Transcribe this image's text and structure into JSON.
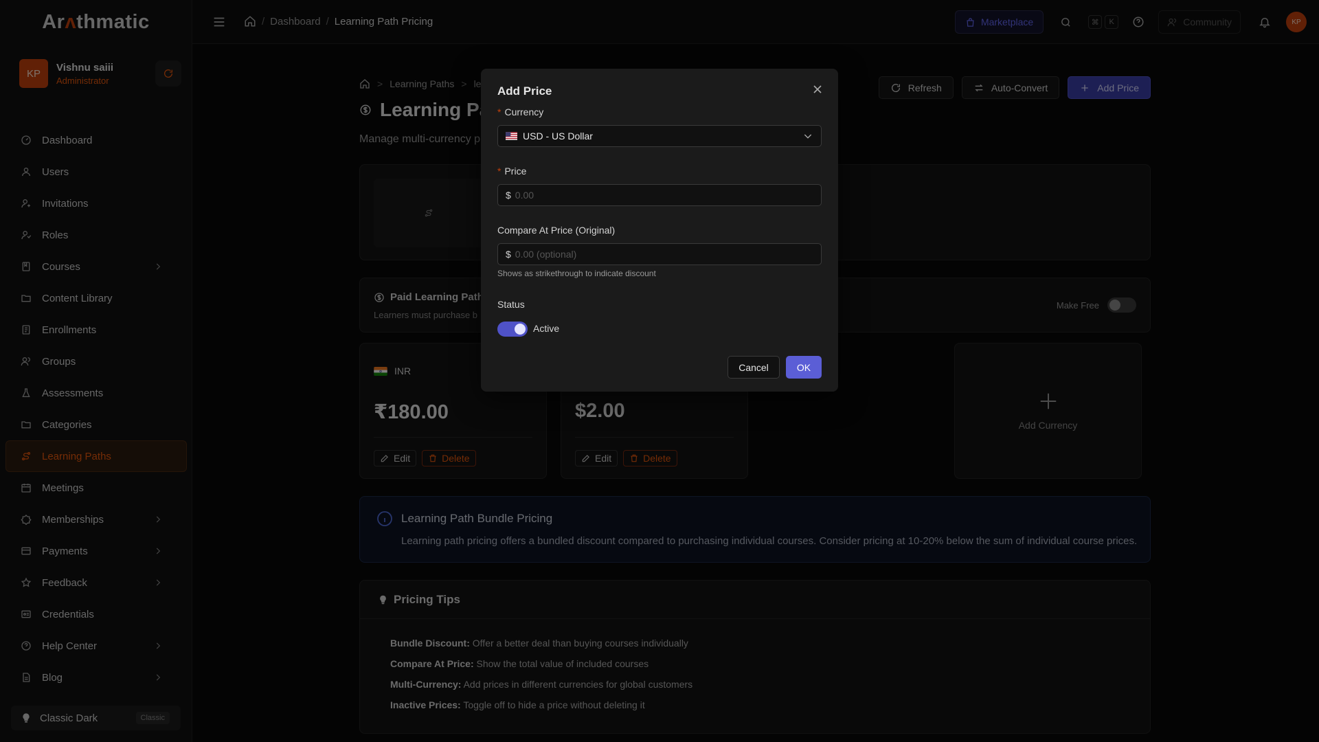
{
  "app": {
    "logo_pre": "Ar",
    "logo_mid": "ʌ",
    "logo_post": "thmatic"
  },
  "user": {
    "initials": "KP",
    "name": "Vishnu saiii",
    "role": "Administrator"
  },
  "sidebar": {
    "items": [
      {
        "label": "Dashboard",
        "icon": "dashboard-icon"
      },
      {
        "label": "Users",
        "icon": "user-icon"
      },
      {
        "label": "Invitations",
        "icon": "user-plus-icon"
      },
      {
        "label": "Roles",
        "icon": "roles-icon"
      },
      {
        "label": "Courses",
        "icon": "book-icon",
        "expandable": true
      },
      {
        "label": "Content Library",
        "icon": "folder-icon"
      },
      {
        "label": "Enrollments",
        "icon": "enrollment-icon"
      },
      {
        "label": "Groups",
        "icon": "group-icon"
      },
      {
        "label": "Assessments",
        "icon": "flask-icon"
      },
      {
        "label": "Categories",
        "icon": "folder-icon"
      },
      {
        "label": "Learning Paths",
        "icon": "route-icon",
        "active": true
      },
      {
        "label": "Meetings",
        "icon": "calendar-icon"
      },
      {
        "label": "Memberships",
        "icon": "badge-icon",
        "expandable": true
      },
      {
        "label": "Payments",
        "icon": "card-icon",
        "expandable": true
      },
      {
        "label": "Feedback",
        "icon": "star-icon",
        "expandable": true
      },
      {
        "label": "Credentials",
        "icon": "certificate-icon"
      },
      {
        "label": "Help Center",
        "icon": "help-icon",
        "expandable": true
      },
      {
        "label": "Blog",
        "icon": "document-icon",
        "expandable": true
      }
    ],
    "theme": {
      "label": "Classic Dark",
      "tag": "Classic"
    }
  },
  "topbar": {
    "breadcrumb": [
      "Dashboard",
      "Learning Path Pricing"
    ],
    "marketplace": "Marketplace",
    "kbd": [
      "⌘",
      "K"
    ],
    "community": "Community",
    "avatar_initials": "KP"
  },
  "page": {
    "breadcrumb": [
      "Learning Paths",
      "le"
    ],
    "title": "Learning Pa",
    "subtitle": "Manage multi-currency p",
    "actions": {
      "refresh": "Refresh",
      "auto_convert": "Auto-Convert",
      "add_price": "Add Price"
    },
    "paid": {
      "title": "Paid Learning Path",
      "subtitle": "Learners must purchase b",
      "make_free": "Make Free",
      "make_free_on": false
    },
    "prices": [
      {
        "currency": "INR",
        "amount": "₹180.00"
      },
      {
        "currency": "",
        "amount": "$2.00"
      }
    ],
    "edit": "Edit",
    "delete": "Delete",
    "add_currency": "Add Currency",
    "bundle": {
      "title": "Learning Path Bundle Pricing",
      "text": "Learning path pricing offers a bundled discount compared to purchasing individual courses. Consider pricing at 10-20% below the sum of individual course prices."
    },
    "tips": {
      "title": "Pricing Tips",
      "items": [
        {
          "k": "Bundle Discount:",
          "v": "Offer a better deal than buying courses individually"
        },
        {
          "k": "Compare At Price:",
          "v": "Show the total value of included courses"
        },
        {
          "k": "Multi-Currency:",
          "v": "Add prices in different currencies for global customers"
        },
        {
          "k": "Inactive Prices:",
          "v": "Toggle off to hide a price without deleting it"
        }
      ]
    }
  },
  "modal": {
    "title": "Add Price",
    "currency_label": "Currency",
    "currency_value": "USD - US Dollar",
    "price_label": "Price",
    "price_prefix": "$",
    "price_placeholder": "0.00",
    "compare_label": "Compare At Price (Original)",
    "compare_prefix": "$",
    "compare_placeholder": "0.00 (optional)",
    "compare_help": "Shows as strikethrough to indicate discount",
    "status_label": "Status",
    "status_value": "Active",
    "status_on": true,
    "cancel": "Cancel",
    "ok": "OK"
  }
}
